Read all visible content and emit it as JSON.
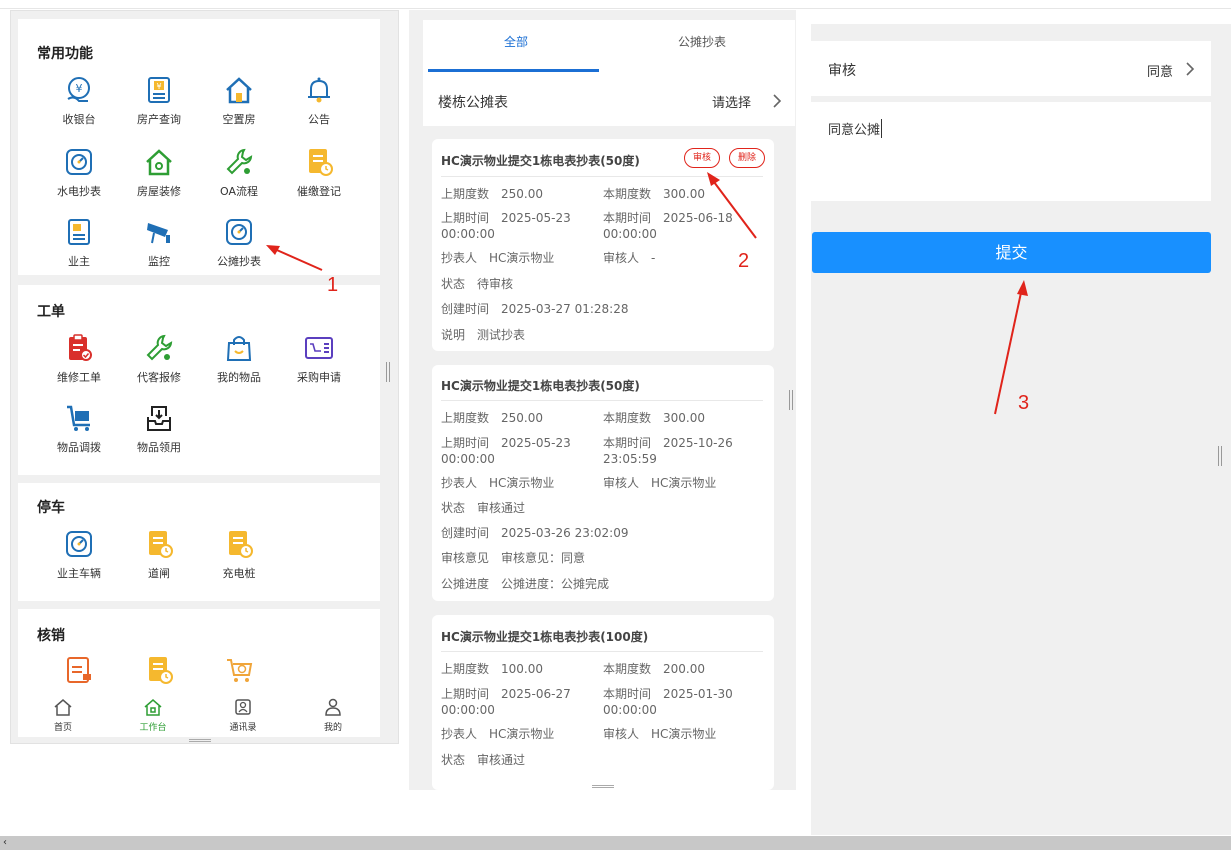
{
  "left_panel": {
    "sections": [
      {
        "title": "常用功能",
        "items": [
          {
            "label": "收银台",
            "icon": "cashier-icon"
          },
          {
            "label": "房产查询",
            "icon": "property-query-icon"
          },
          {
            "label": "空置房",
            "icon": "vacant-house-icon"
          },
          {
            "label": "公告",
            "icon": "bell-icon"
          },
          {
            "label": "水电抄表",
            "icon": "meter-icon"
          },
          {
            "label": "房屋装修",
            "icon": "house-renovation-icon"
          },
          {
            "label": "OA流程",
            "icon": "wrench-icon"
          },
          {
            "label": "催缴登记",
            "icon": "document-clock-icon"
          },
          {
            "label": "业主",
            "icon": "owner-icon"
          },
          {
            "label": "监控",
            "icon": "camera-icon"
          },
          {
            "label": "公摊抄表",
            "icon": "shared-meter-icon"
          }
        ]
      },
      {
        "title": "工单",
        "items": [
          {
            "label": "维修工单",
            "icon": "clipboard-icon"
          },
          {
            "label": "代客报修",
            "icon": "wrench-icon"
          },
          {
            "label": "我的物品",
            "icon": "bag-icon"
          },
          {
            "label": "采购申请",
            "icon": "purchase-icon"
          },
          {
            "label": "物品调拨",
            "icon": "cart-transfer-icon"
          },
          {
            "label": "物品领用",
            "icon": "inbox-icon"
          }
        ]
      },
      {
        "title": "停车",
        "items": [
          {
            "label": "业主车辆",
            "icon": "meter-icon"
          },
          {
            "label": "道闸",
            "icon": "document-clock-icon"
          },
          {
            "label": "充电桩",
            "icon": "document-clock-icon"
          }
        ]
      },
      {
        "title": "核销",
        "items": [
          {
            "label": "",
            "icon": "verify-icon"
          },
          {
            "label": "",
            "icon": "document-clock-icon"
          },
          {
            "label": "",
            "icon": "cart-icon"
          }
        ]
      }
    ],
    "tabbar": [
      {
        "label": "首页",
        "icon": "home-icon"
      },
      {
        "label": "工作台",
        "icon": "workbench-icon"
      },
      {
        "label": "通讯录",
        "icon": "contacts-icon"
      },
      {
        "label": "我的",
        "icon": "user-icon"
      }
    ],
    "annotation": "1"
  },
  "middle_panel": {
    "tabs": [
      "全部",
      "公摊抄表"
    ],
    "selector": {
      "label": "楼栋公摊表",
      "value": "请选择"
    },
    "cards": [
      {
        "title": "HC演示物业提交1栋电表抄表(50度)",
        "buttons": [
          "审核",
          "删除"
        ],
        "last_reading_label": "上期度数",
        "last_reading": "250.00",
        "this_reading_label": "本期度数",
        "this_reading": "300.00",
        "last_time_label": "上期时间",
        "last_time_1": "2025-05-23",
        "last_time_2": "00:00:00",
        "this_time_label": "本期时间",
        "this_time_1": "2025-06-18",
        "this_time_2": "00:00:00",
        "reader_label": "抄表人",
        "reader": "HC演示物业",
        "auditor_label": "审核人",
        "auditor": "-",
        "extra": [
          {
            "label": "状态",
            "value": "待审核"
          },
          {
            "label": "创建时间",
            "value": "2025-03-27 01:28:28"
          },
          {
            "label": "说明",
            "value": "测试抄表"
          }
        ]
      },
      {
        "title": "HC演示物业提交1栋电表抄表(50度)",
        "buttons": [],
        "last_reading_label": "上期度数",
        "last_reading": "250.00",
        "this_reading_label": "本期度数",
        "this_reading": "300.00",
        "last_time_label": "上期时间",
        "last_time_1": "2025-05-23",
        "last_time_2": "00:00:00",
        "this_time_label": "本期时间",
        "this_time_1": "2025-10-26",
        "this_time_2": "23:05:59",
        "reader_label": "抄表人",
        "reader": "HC演示物业",
        "auditor_label": "审核人",
        "auditor": "HC演示物业",
        "extra": [
          {
            "label": "状态",
            "value": "审核通过"
          },
          {
            "label": "创建时间",
            "value": "2025-03-26 23:02:09"
          },
          {
            "label": "审核意见",
            "value": "审核意见：同意"
          },
          {
            "label": "公摊进度",
            "value": "公摊进度：公摊完成"
          }
        ]
      },
      {
        "title": "HC演示物业提交1栋电表抄表(100度)",
        "buttons": [],
        "last_reading_label": "上期度数",
        "last_reading": "100.00",
        "this_reading_label": "本期度数",
        "this_reading": "200.00",
        "last_time_label": "上期时间",
        "last_time_1": "2025-06-27",
        "last_time_2": "00:00:00",
        "this_time_label": "本期时间",
        "this_time_1": "2025-01-30",
        "this_time_2": "00:00:00",
        "reader_label": "抄表人",
        "reader": "HC演示物业",
        "auditor_label": "审核人",
        "auditor": "HC演示物业",
        "extra": [
          {
            "label": "状态",
            "value": "审核通过"
          }
        ]
      }
    ],
    "annotation": "2"
  },
  "right_panel": {
    "row_label": "审核",
    "row_value": "同意",
    "textarea_value": "同意公摊",
    "submit_label": "提交",
    "annotation": "3"
  },
  "colors": {
    "primary": "#1890ff",
    "tab_active": "#1b6fd4",
    "annotation": "#e0241b",
    "workbench_active": "#2e9e34"
  }
}
